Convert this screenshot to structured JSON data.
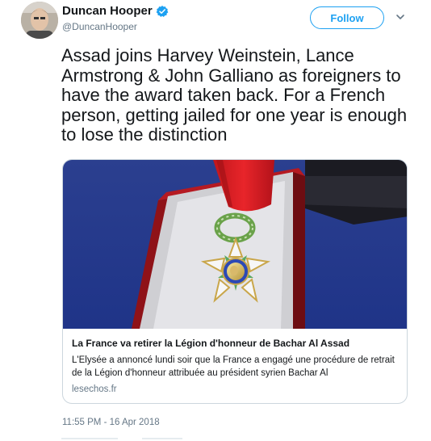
{
  "author": {
    "name": "Duncan Hooper",
    "handle": "@DuncanHooper",
    "verified_icon": "verified-badge-icon",
    "avatar": "avatar"
  },
  "actions": {
    "follow_label": "Follow",
    "menu_icon": "chevron-down-icon"
  },
  "tweet": {
    "text": "Assad joins Harvey Weinstein, Lance Armstrong & John Galliano as foreigners to have the award taken back. For a French person, getting jailed for one year is enough to lose the distinction",
    "timestamp": "11:55 PM - 16 Apr 2018"
  },
  "card": {
    "image": "legion-of-honour-medal-image",
    "title": "La France va retirer la Légion d'honneur de Bachar Al Assad",
    "description": "L'Elysée a annoncé lundi soir que la France a engagé une procédure de retrait de la Légion d'honneur attribuée au président syrien Bachar Al",
    "domain": "lesechos.fr"
  },
  "colors": {
    "accent": "#1da1f2",
    "text": "#14171a",
    "secondary_text": "#657786",
    "border": "#ccd6dd"
  }
}
